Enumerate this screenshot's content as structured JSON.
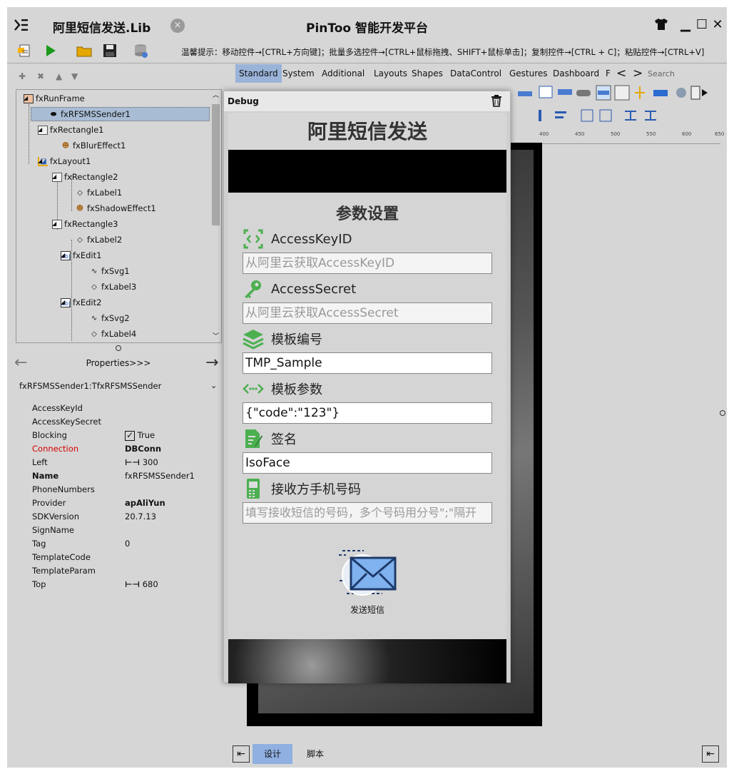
{
  "window": {
    "doc_title": "阿里短信发送.Lib",
    "close_tab_glyph": "×",
    "app_title": "PinToo 智能开发平台",
    "min_glyph": "▁",
    "max_glyph": "☐",
    "close_glyph": "✕"
  },
  "toolbar": {
    "hint": "温馨提示：移动控件→[CTRL+方向键]；批量多选控件→[CTRL+鼠标拖拽、SHIFT+鼠标单击]；复制控件→[CTRL + C]；粘贴控件→[CTRL+V]",
    "icons": [
      "new-page-icon",
      "run-icon",
      "open-folder-icon",
      "save-icon",
      "database-icon"
    ]
  },
  "palette": {
    "tabs": [
      "Standard",
      "System",
      "Additional",
      "Layouts",
      "Shapes",
      "DataControl",
      "Gestures",
      "Dashboard",
      "F"
    ],
    "active": "Standard",
    "search_placeholder": "Search",
    "prev_glyph": "<",
    "next_glyph": ">"
  },
  "ruler": {
    "labels": [
      "400",
      "450",
      "500",
      "550",
      "600",
      "650"
    ]
  },
  "tree": {
    "nodes": [
      {
        "label": "fxRunFrame",
        "icon": "form-icon"
      },
      {
        "label": "fxRFSMSSender1",
        "icon": "sms-component-icon"
      },
      {
        "label": "fxRectangle1",
        "icon": "rectangle-icon"
      },
      {
        "label": "fxBlurEffect1",
        "icon": "effect-icon"
      },
      {
        "label": "fxLayout1",
        "icon": "layout-icon"
      },
      {
        "label": "fxRectangle2",
        "icon": "rectangle-icon"
      },
      {
        "label": "fxLabel1",
        "icon": "label-icon"
      },
      {
        "label": "fxShadowEffect1",
        "icon": "effect-icon"
      },
      {
        "label": "fxRectangle3",
        "icon": "rectangle-icon"
      },
      {
        "label": "fxLabel2",
        "icon": "label-icon"
      },
      {
        "label": "fxEdit1",
        "icon": "edit-icon"
      },
      {
        "label": "fxSvg1",
        "icon": "svg-icon"
      },
      {
        "label": "fxLabel3",
        "icon": "label-icon"
      },
      {
        "label": "fxEdit2",
        "icon": "edit-icon"
      },
      {
        "label": "fxSvg2",
        "icon": "svg-icon"
      },
      {
        "label": "fxLabel4",
        "icon": "label-icon"
      }
    ]
  },
  "properties": {
    "header": "Properties>>>",
    "prev_glyph": "←",
    "next_glyph": "→",
    "object": "fxRFSMSSender1:TfxRFSMSSender",
    "rows": [
      {
        "name": "AccessKeyId",
        "value": ""
      },
      {
        "name": "AccessKeySecret",
        "value": ""
      },
      {
        "name": "Blocking",
        "value": "True"
      },
      {
        "name": "Connection",
        "value": "DBConn"
      },
      {
        "name": "Left",
        "value": "300"
      },
      {
        "name": "Name",
        "value": "fxRFSMSSender1"
      },
      {
        "name": "PhoneNumbers",
        "value": ""
      },
      {
        "name": "Provider",
        "value": "apAliYun"
      },
      {
        "name": "SDKVersion",
        "value": "20.7.13"
      },
      {
        "name": "SignName",
        "value": ""
      },
      {
        "name": "Tag",
        "value": "0"
      },
      {
        "name": "TemplateCode",
        "value": ""
      },
      {
        "name": "TemplateParam",
        "value": ""
      },
      {
        "name": "Top",
        "value": "680"
      }
    ],
    "colors": {
      "connection": "#d40000"
    }
  },
  "debug": {
    "title": "Debug",
    "app_title": "阿里短信发送",
    "section_title": "参数设置",
    "fields": [
      {
        "label": "AccessKeyID",
        "value": "",
        "placeholder": "从阿里云获取AccessKeyID",
        "icon": "code-icon"
      },
      {
        "label": "AccessSecret",
        "value": "",
        "placeholder": "从阿里云获取AccessSecret",
        "icon": "key-icon"
      },
      {
        "label": "模板编号",
        "value": "TMP_Sample",
        "placeholder": "",
        "icon": "layers-icon"
      },
      {
        "label": "模板参数",
        "value": "{\"code\":\"123\"}",
        "placeholder": "",
        "icon": "dots-code-icon"
      },
      {
        "label": "签名",
        "value": "IsoFace",
        "placeholder": "",
        "icon": "sign-doc-icon"
      },
      {
        "label": "接收方手机号码",
        "value": "",
        "placeholder": "填写接收短信的号码，多个号码用分号\";\"隔开",
        "icon": "phone-icon"
      }
    ],
    "send_label": "发送短信",
    "accent": "#4caf50"
  },
  "bottom": {
    "tabs": [
      "设计",
      "脚本"
    ],
    "active": "设计"
  }
}
